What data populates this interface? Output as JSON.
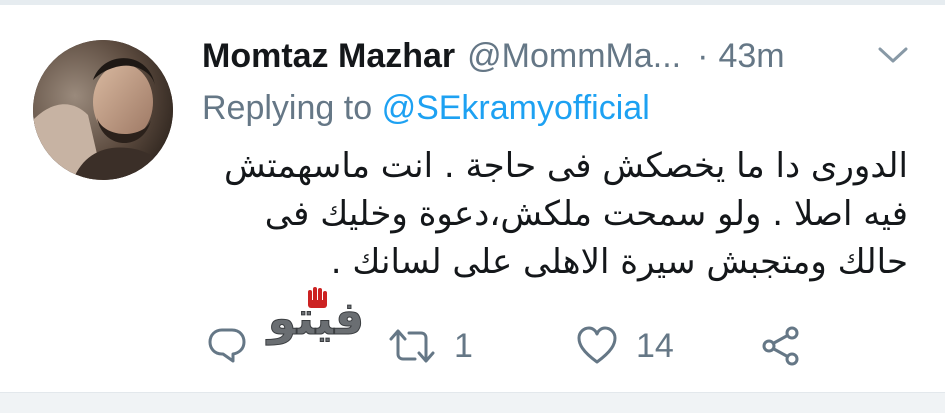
{
  "tweet": {
    "display_name": "Momtaz Mazhar",
    "handle": "@MommMa...",
    "separator": "·",
    "time": "43m",
    "replying_prefix": "Replying to",
    "replying_to": "@SEkramyofficial",
    "text_lines": [
      "الدورى دا ما يخصكش فى حاجة . انت ماسهمتش",
      "فيه اصلا . ولو سمحت ملكش،دعوة وخليك فى",
      "حالك ومتجبش سيرة الاهلى على لسانك ."
    ]
  },
  "actions": {
    "reply": {
      "icon": "reply-icon",
      "count": ""
    },
    "retweet": {
      "icon": "retweet-icon",
      "count": "1"
    },
    "like": {
      "icon": "heart-icon",
      "count": "14"
    },
    "share": {
      "icon": "share-icon",
      "count": ""
    }
  },
  "watermark": {
    "text": "فيتو"
  },
  "colors": {
    "text": "#14171a",
    "muted": "#657786",
    "link": "#1da1f2"
  }
}
